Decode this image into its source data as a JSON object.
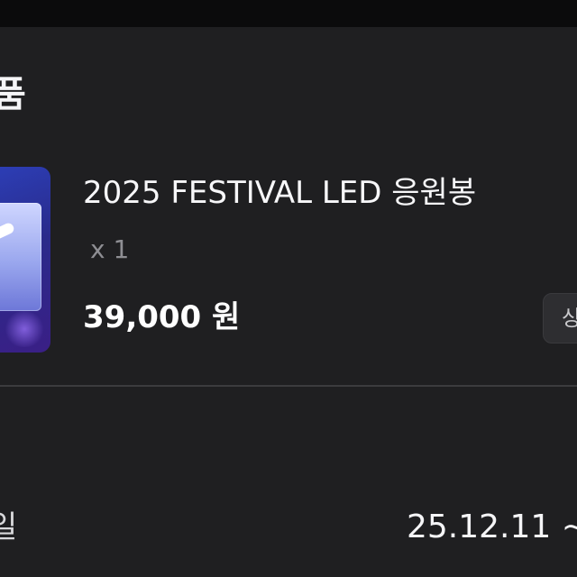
{
  "section": {
    "title": "품"
  },
  "product": {
    "name": "2025 FESTIVAL LED 응원봉",
    "quantity": "x 1",
    "price": "39,000 원",
    "detail_button_label": "상"
  },
  "info_row": {
    "label": "일",
    "value": "25.12.11 ~"
  },
  "colors": {
    "background": "#1f1f21",
    "text_primary": "#f5f5f7",
    "text_secondary": "#8e8e93",
    "divider": "#3b3b3e",
    "thumbnail_accent": "#2c3fb8"
  },
  "icons": {
    "thumbnail": "lightstick-product-image"
  }
}
